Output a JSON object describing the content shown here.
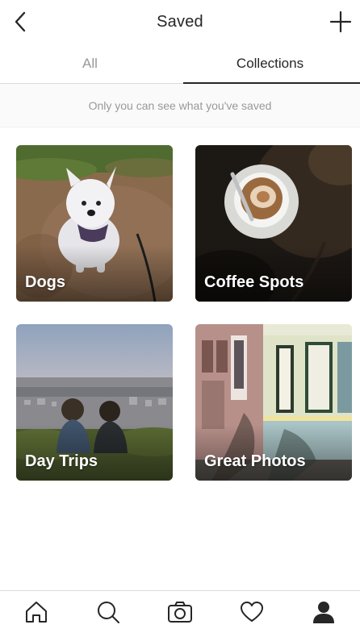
{
  "header": {
    "title": "Saved",
    "back_icon": "chevron-left-icon",
    "add_icon": "plus-icon"
  },
  "tabs": [
    {
      "label": "All",
      "active": false
    },
    {
      "label": "Collections",
      "active": true
    }
  ],
  "notice": "Only you can see what you've saved",
  "collections": [
    {
      "name": "Dogs"
    },
    {
      "name": "Coffee Spots"
    },
    {
      "name": "Day Trips"
    },
    {
      "name": "Great Photos"
    }
  ],
  "bottom_nav": [
    {
      "icon": "home-icon"
    },
    {
      "icon": "search-icon"
    },
    {
      "icon": "camera-icon"
    },
    {
      "icon": "heart-icon"
    },
    {
      "icon": "profile-icon",
      "active": true
    }
  ],
  "colors": {
    "text": "#262626",
    "muted": "#999999",
    "divider": "#dbdbdb",
    "notice_bg": "#fafafa"
  }
}
